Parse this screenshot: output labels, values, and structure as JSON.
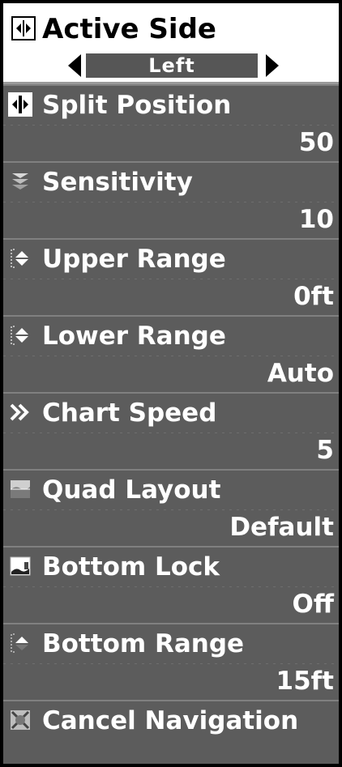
{
  "active_side": {
    "title": "Active Side",
    "icon": "split-screen-icon",
    "selected_value": "Left"
  },
  "items": [
    {
      "label": "Split Position",
      "value": "50",
      "icon": "split-position-icon"
    },
    {
      "label": "Sensitivity",
      "value": "10",
      "icon": "sensitivity-icon"
    },
    {
      "label": "Upper Range",
      "value": "0ft",
      "icon": "upper-range-icon"
    },
    {
      "label": "Lower Range",
      "value": "Auto",
      "icon": "lower-range-icon"
    },
    {
      "label": "Chart Speed",
      "value": "5",
      "icon": "chart-speed-icon"
    },
    {
      "label": "Quad Layout",
      "value": "Default",
      "icon": "quad-layout-icon"
    },
    {
      "label": "Bottom Lock",
      "value": "Off",
      "icon": "bottom-lock-icon"
    },
    {
      "label": "Bottom Range",
      "value": "15ft",
      "icon": "bottom-range-icon"
    },
    {
      "label": "Cancel Navigation",
      "value": "",
      "icon": "cancel-navigation-icon"
    }
  ],
  "colors": {
    "header_bg": "#ffffff",
    "item_bg": "#5c5c5c",
    "text": "#ffffff"
  }
}
